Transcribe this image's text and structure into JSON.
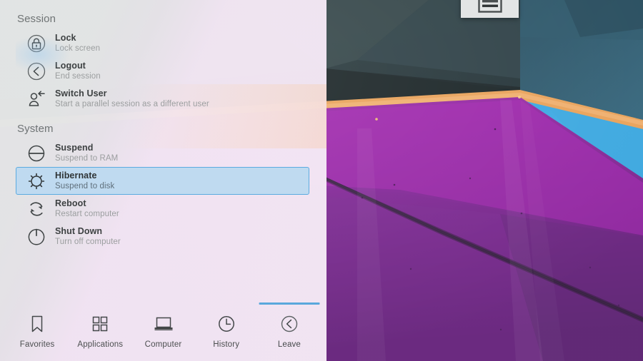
{
  "theme": {
    "panel_bg_top": "#e4e6e6",
    "panel_bg_bottom": "#f3e7f4",
    "accent": "#5aa8dc",
    "selection_fill": "#bfdaf0",
    "selection_border": "#5babe0",
    "title_color": "#3d4142",
    "subtitle_color": "#9b9e9f",
    "header_color": "#6f7475"
  },
  "top_popup": {
    "name": "document-preview-popup",
    "icon": "document-lines-icon",
    "bg": "#e3e5e5"
  },
  "panel": {
    "groups": [
      {
        "header": "Session",
        "items": [
          {
            "icon": "lock-icon",
            "title": "Lock",
            "subtitle": "Lock screen",
            "selected": false
          },
          {
            "icon": "logout-icon",
            "title": "Logout",
            "subtitle": "End session",
            "selected": false
          },
          {
            "icon": "switch-user-icon",
            "title": "Switch User",
            "subtitle": "Start a parallel session as a different user",
            "selected": false
          }
        ]
      },
      {
        "header": "System",
        "items": [
          {
            "icon": "suspend-icon",
            "title": "Suspend",
            "subtitle": "Suspend to RAM",
            "selected": false
          },
          {
            "icon": "hibernate-icon",
            "title": "Hibernate",
            "subtitle": "Suspend to disk",
            "selected": true
          },
          {
            "icon": "reboot-icon",
            "title": "Reboot",
            "subtitle": "Restart computer",
            "selected": false
          },
          {
            "icon": "shutdown-icon",
            "title": "Shut Down",
            "subtitle": "Turn off computer",
            "selected": false
          }
        ]
      }
    ]
  },
  "tabbar": {
    "tabs": [
      {
        "icon": "bookmark-icon",
        "label": "Favorites",
        "active": false
      },
      {
        "icon": "grid-squares-icon",
        "label": "Applications",
        "active": false
      },
      {
        "icon": "laptop-icon",
        "label": "Computer",
        "active": false
      },
      {
        "icon": "clock-icon",
        "label": "History",
        "active": false
      },
      {
        "icon": "leave-back-icon",
        "label": "Leave",
        "active": true
      }
    ]
  },
  "wallpaper": {
    "name": "geometric-abstract-wallpaper",
    "colors": {
      "dark_teal": "#2c3a3c",
      "dark_teal_2": "#334244",
      "dark_slate": "#1f2a2c",
      "blue_teal": "#2c5668",
      "steel_blue": "#356277",
      "orange_line": "#e9a35c",
      "sky_blue": "#3fa9e0",
      "magenta": "#a32bb0",
      "purple": "#7e2d93",
      "deep_purple": "#5f2a70"
    }
  }
}
